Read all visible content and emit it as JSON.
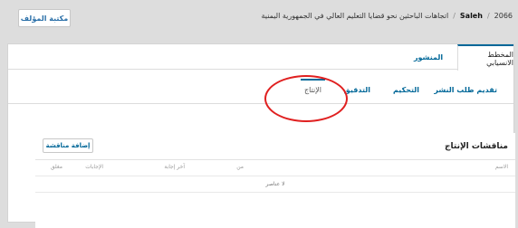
{
  "header": {
    "library_button": "مكتبة المؤلف",
    "breadcrumb": {
      "id": "2066",
      "author": "Saleh",
      "title": "اتجاهات الباحثين نحو قضايا التعليم العالي في الجمهورية اليمنية"
    }
  },
  "main_tabs": [
    "المخطط الانسيابي",
    "المنشور"
  ],
  "stage_tabs": [
    "تقديم طلب النشر",
    "التحكيم",
    "التدقيق",
    "الإنتاج"
  ],
  "discussions": {
    "title": "مناقشات الإنتاج",
    "add_button": "إضافة مناقشة",
    "columns": [
      "الاسم",
      "من",
      "آخر إجابة",
      "الإجابات",
      "مغلق"
    ],
    "empty_message": "لا عناصر"
  },
  "colors": {
    "accent": "#006798",
    "annotation": "#e02020"
  }
}
